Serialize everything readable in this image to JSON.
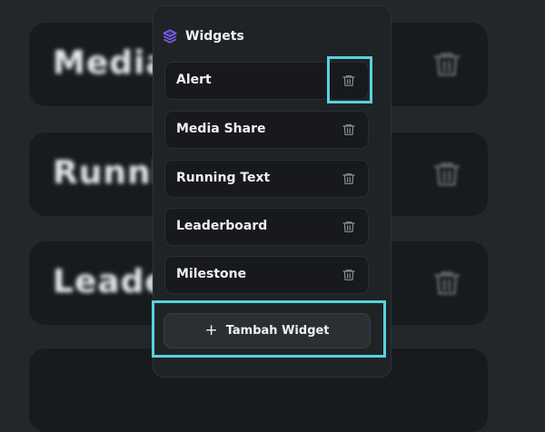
{
  "background": {
    "cards": [
      {
        "text": "Media"
      },
      {
        "text": "Runnii"
      },
      {
        "text": "Leade"
      }
    ]
  },
  "panel": {
    "title": "Widgets",
    "title_icon": "layers-icon",
    "accent_color": "#7c5cf0",
    "highlight_color": "#57d2df",
    "items": [
      {
        "label": "Alert",
        "action_icon": "trash-icon"
      },
      {
        "label": "Media Share",
        "action_icon": "trash-icon"
      },
      {
        "label": "Running Text",
        "action_icon": "trash-icon"
      },
      {
        "label": "Leaderboard",
        "action_icon": "trash-icon"
      },
      {
        "label": "Milestone",
        "action_icon": "trash-icon"
      }
    ],
    "add_button": {
      "icon": "+",
      "label": "Tambah Widget"
    }
  }
}
